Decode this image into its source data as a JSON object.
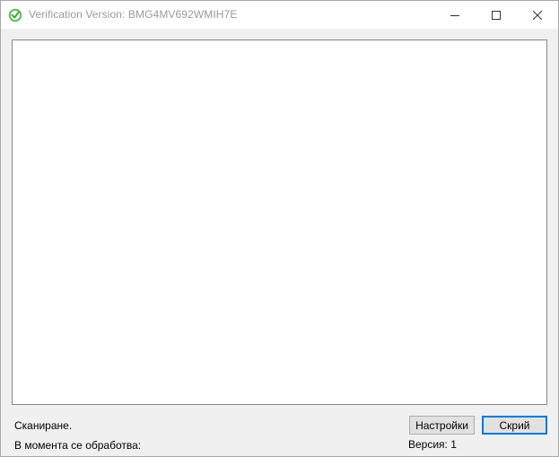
{
  "window": {
    "title": "Verification Version: BMG4MV692WMIH7E",
    "icon": "check-shield-icon",
    "controls": {
      "minimize_icon": "minimize-icon",
      "maximize_icon": "maximize-icon",
      "close_icon": "close-icon"
    }
  },
  "status": {
    "scanning": "Сканиране.",
    "processing": "В момента се обработва:",
    "version": "Версия: 1"
  },
  "buttons": {
    "settings_label": "Настройки",
    "hide_label": "Скрий"
  },
  "colors": {
    "accent": "#0078d7",
    "icon_green": "#4caf50",
    "title_text": "#9a9a9a"
  }
}
